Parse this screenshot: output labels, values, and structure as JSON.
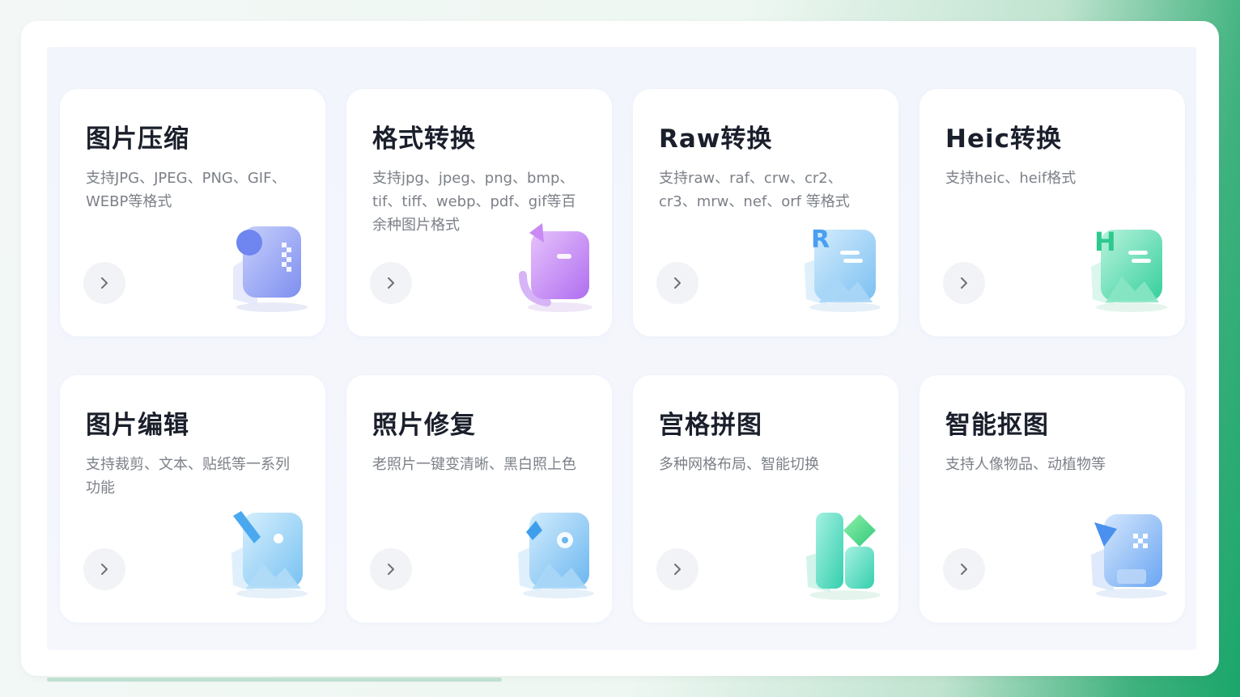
{
  "tools": [
    {
      "title": "图片压缩",
      "desc": "支持JPG、JPEG、PNG、GIF、WEBP等格式",
      "icon": "image-compress-icon",
      "color": "#8b9cf0"
    },
    {
      "title": "格式转换",
      "desc": "支持jpg、jpeg、png、bmp、tif、tiff、webp、pdf、gif等百余种图片格式",
      "icon": "format-convert-icon",
      "color": "#c47ef0"
    },
    {
      "title": "Raw转换",
      "desc": "支持raw、raf、crw、cr2、cr3、mrw、nef、orf 等格式",
      "icon": "raw-convert-icon",
      "color": "#6fb8f0"
    },
    {
      "title": "Heic转换",
      "desc": "支持heic、heif格式",
      "icon": "heic-convert-icon",
      "color": "#3dd6a6"
    },
    {
      "title": "图片编辑",
      "desc": "支持裁剪、文本、贴纸等一系列功能",
      "icon": "image-edit-icon",
      "color": "#6fc3f2"
    },
    {
      "title": "照片修复",
      "desc": "老照片一键变清晰、黑白照上色",
      "icon": "photo-restore-icon",
      "color": "#5fb6f0"
    },
    {
      "title": "宫格拼图",
      "desc": "多种网格布局、智能切换",
      "icon": "grid-collage-icon",
      "color": "#3ed6b0"
    },
    {
      "title": "智能抠图",
      "desc": "支持人像物品、动植物等",
      "icon": "smart-cutout-icon",
      "color": "#6aaaf2"
    }
  ]
}
